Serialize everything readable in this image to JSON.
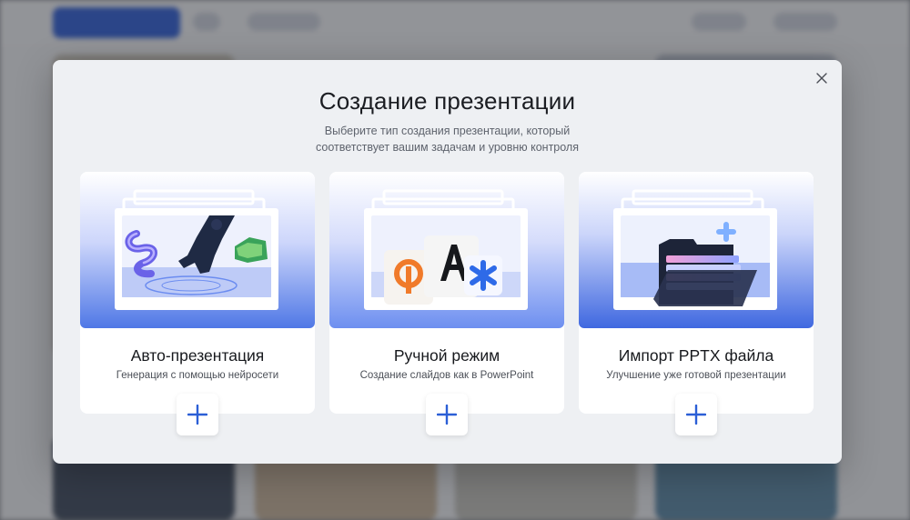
{
  "modal": {
    "title": "Создание презентации",
    "subtitle_line1": "Выберите тип создания презентации, который",
    "subtitle_line2": "соответствует вашим задачам и уровню контроля",
    "close_icon": "close-icon"
  },
  "cards": [
    {
      "title": "Авто-презентация",
      "description": "Генерация с помощью нейросети",
      "icon": "plus-icon"
    },
    {
      "title": "Ручной режим",
      "description": "Создание слайдов как в PowerPoint",
      "icon": "plus-icon"
    },
    {
      "title": "Импорт PPTX файла",
      "description": "Улучшение уже готовой презентации",
      "icon": "plus-icon"
    }
  ],
  "colors": {
    "accent": "#2b5fd6",
    "modal_bg": "#eef0f3",
    "card_bg": "#ffffff"
  }
}
